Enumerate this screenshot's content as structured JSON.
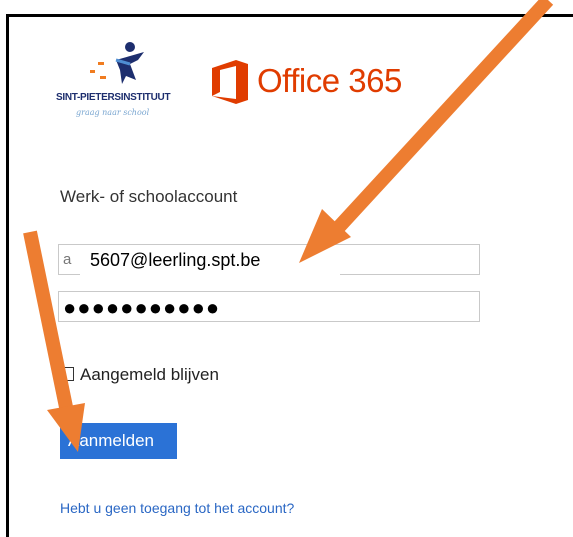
{
  "school": {
    "name": "SINT-PIETERSINSTITUUT",
    "tagline": "graag naar school"
  },
  "office": {
    "brand": "Office 365"
  },
  "login": {
    "account_label": "Werk- of schoolaccount",
    "email_hidden_prefix": "a",
    "email_value": "5607@leerling.spt.be",
    "password_masked": "●●●●●●●●●●●",
    "remember_label": "Aangemeld blijven",
    "remember_checked": false,
    "signin_label": "Aanmelden",
    "no_access_link": "Hebt u geen toegang tot het account?"
  },
  "colors": {
    "office_orange": "#e03c00",
    "signin_blue": "#2b72d6",
    "link_blue": "#2a67c4",
    "annotation_arrow": "#ed7d31"
  },
  "annotations": {
    "arrows": [
      "arrow-to-email-field",
      "arrow-to-signin-button"
    ]
  }
}
